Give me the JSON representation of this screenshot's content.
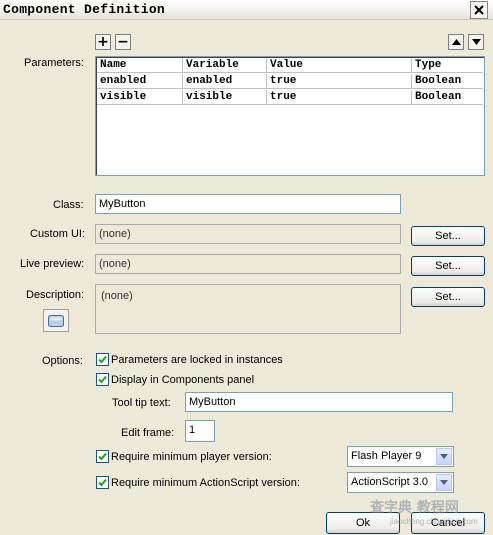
{
  "window": {
    "title": "Component Definition"
  },
  "parameters": {
    "label": "Parameters:",
    "columns": [
      "Name",
      "Variable",
      "Value",
      "Type"
    ],
    "rows": [
      [
        "enabled",
        "enabled",
        "true",
        "Boolean"
      ],
      [
        "visible",
        "visible",
        "true",
        "Boolean"
      ]
    ]
  },
  "class": {
    "label": "Class:",
    "value": "MyButton"
  },
  "custom_ui": {
    "label": "Custom UI:",
    "value": "(none)",
    "button": "Set..."
  },
  "live_preview": {
    "label": "Live preview:",
    "value": "(none)",
    "button": "Set..."
  },
  "description": {
    "label": "Description:",
    "value": "(none)",
    "button": "Set..."
  },
  "options": {
    "label": "Options:",
    "locked": {
      "label": "Parameters are locked in instances",
      "checked": true
    },
    "display": {
      "label": "Display in Components panel",
      "checked": true
    },
    "tooltip": {
      "label": "Tool tip text:",
      "value": "MyButton"
    },
    "edit_frame": {
      "label": "Edit frame:",
      "value": "1"
    },
    "min_player": {
      "label": "Require minimum player version:",
      "checked": true,
      "selected": "Flash Player 9"
    },
    "min_as": {
      "label": "Require minimum ActionScript version:",
      "checked": true,
      "selected": "ActionScript 3.0"
    }
  },
  "footer": {
    "ok": "Ok",
    "cancel": "Cancel"
  },
  "watermark": {
    "line1": "查字典 教程网",
    "line2": "jiaocheng.chazidian.com"
  },
  "icons": [
    "close-icon",
    "plus-icon",
    "minus-icon",
    "move-up-icon",
    "move-down-icon",
    "component-icon",
    "check-icon",
    "dropdown-arrow-icon"
  ]
}
